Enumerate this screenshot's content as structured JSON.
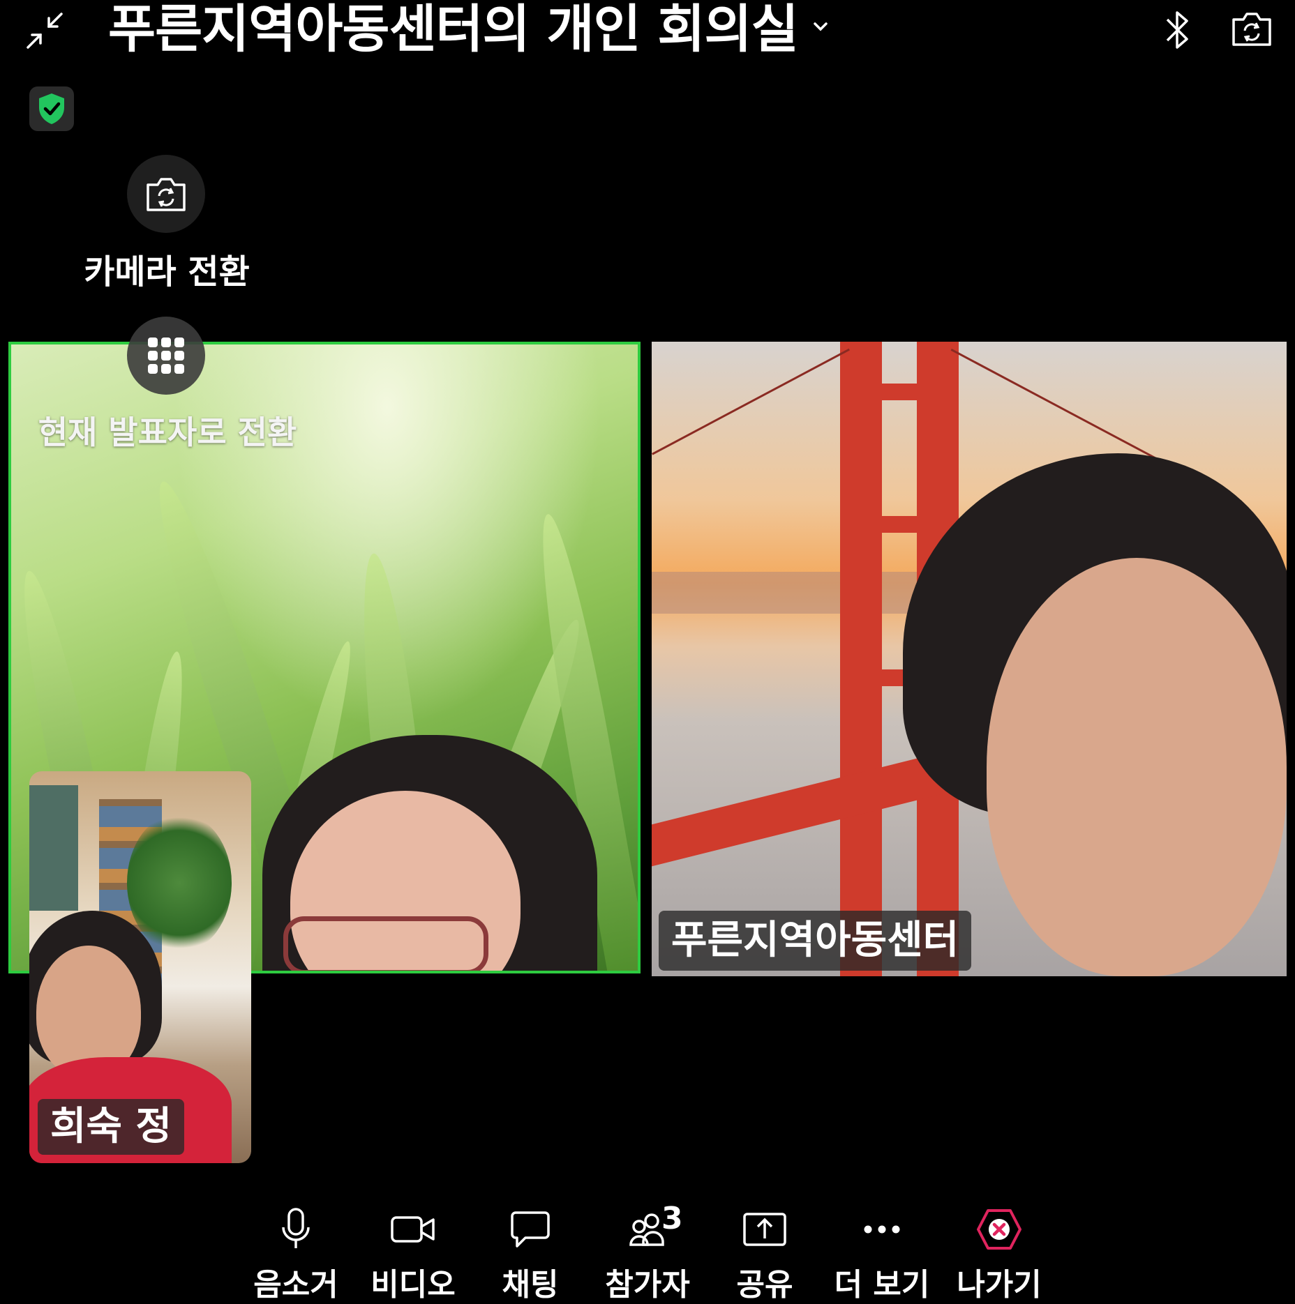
{
  "header": {
    "title": "푸른지역아동센터의 개인 회의실",
    "icons": {
      "minimize": "minimize-arrows-icon",
      "dropdown": "chevron-down-icon",
      "bluetooth": "bluetooth-icon",
      "flip_camera": "flip-camera-icon",
      "security": "shield-check-icon"
    }
  },
  "overlay_menu": {
    "camera_switch_label": "카메라 전환",
    "switch_to_presenter_label": "현재 발표자로 전환"
  },
  "tiles": {
    "left": {
      "background": "grass",
      "active_speaker_color": "#2ecc40"
    },
    "right": {
      "name": "푸른지역아동센터",
      "background": "golden-gate-bridge"
    }
  },
  "self_view": {
    "name": "희숙 정"
  },
  "toolbar": {
    "items": [
      {
        "icon": "microphone-icon",
        "label": "음소거"
      },
      {
        "icon": "video-camera-icon",
        "label": "비디오"
      },
      {
        "icon": "chat-icon",
        "label": "채팅"
      },
      {
        "icon": "participants-icon",
        "label": "참가자",
        "count": "3"
      },
      {
        "icon": "share-icon",
        "label": "공유"
      },
      {
        "icon": "more-icon",
        "label": "더 보기"
      },
      {
        "icon": "leave-icon",
        "label": "나가기",
        "color": "#e0245e"
      }
    ]
  }
}
